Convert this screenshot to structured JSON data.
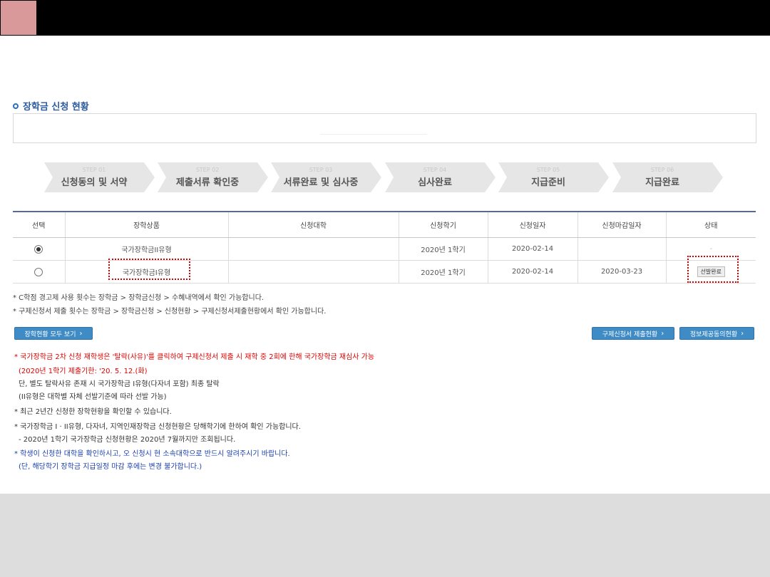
{
  "section_title": "장학금 신청 현황",
  "steps": [
    {
      "num": "STEP 01",
      "label": "신청동의 및 서약"
    },
    {
      "num": "STEP 02",
      "label": "제출서류 확인중"
    },
    {
      "num": "STEP 03",
      "label": "서류완료 및 심사중"
    },
    {
      "num": "STEP 04",
      "label": "심사완료"
    },
    {
      "num": "STEP 05",
      "label": "지급준비"
    },
    {
      "num": "STEP 06",
      "label": "지급완료"
    }
  ],
  "table": {
    "headers": [
      "선택",
      "장학상품",
      "신청대학",
      "신청학기",
      "신청일자",
      "신청마감일자",
      "상태"
    ],
    "rows": [
      {
        "selected": true,
        "product": "국가장학금II유형",
        "university": "",
        "semester": "2020년 1학기",
        "apply_date": "2020-02-14",
        "deadline": "",
        "status": "-"
      },
      {
        "selected": false,
        "product": "국가장학금I유형",
        "university": "",
        "semester": "2020년 1학기",
        "apply_date": "2020-02-14",
        "deadline": "2020-03-23",
        "status": "선발완료"
      }
    ]
  },
  "notes": [
    "* C학점 경고제 사용 횟수는 장학금 > 장학금신청 > 수혜내역에서 확인 가능합니다.",
    "* 구제신청서 제출 횟수는 장학금 > 장학금신청 > 신청현황 > 구제신청서제출현황에서 확인 가능합니다."
  ],
  "buttons": {
    "view_all": "장학현황 모두 보기",
    "relief_status": "구제신청서 제출현황",
    "info_consent": "정보제공동의현황"
  },
  "info_lines": [
    {
      "text": "* 국가장학금 2차 신청 재학생은 '탈락(사유)'를 클릭하여 구제신청서 제출 시 재학 중 2회에 한해 국가장학금 재심사 가능",
      "color": "red"
    },
    {
      "text": "(2020년 1학기 제출기한: '20. 5. 12.(화)",
      "color": "red"
    },
    {
      "text": "단, 별도 탈락사유 존재 시 국가장학금 I유형(다자녀 포함) 최종 탈락",
      "color": "dark"
    },
    {
      "text": "(II유형은 대학별 자체 선발기준에 따라 선발 가능)",
      "color": "dark"
    },
    {
      "text": "* 최근 2년간 신청한 장학현황을 확인할 수 있습니다.",
      "color": "dark"
    },
    {
      "text": "* 국가장학금 I · II유형, 다자녀, 지역인재장학금 신청현황은 당해학기에 한하여 확인 가능합니다.",
      "color": "dark"
    },
    {
      "text": "- 2020년 1학기 국가장학금 신청현황은 2020년 7월까지만 조회됩니다.",
      "color": "dark"
    },
    {
      "text": "* 학생이 신청한 대학을 확인하시고, 오 신청시 현 소속대학으로 반드시 알려주시기 바랍니다.",
      "color": "blue"
    },
    {
      "text": "(단, 해당학기 장학금 지급일정 마감 후에는 변경 불가합니다.)",
      "color": "blue"
    }
  ]
}
